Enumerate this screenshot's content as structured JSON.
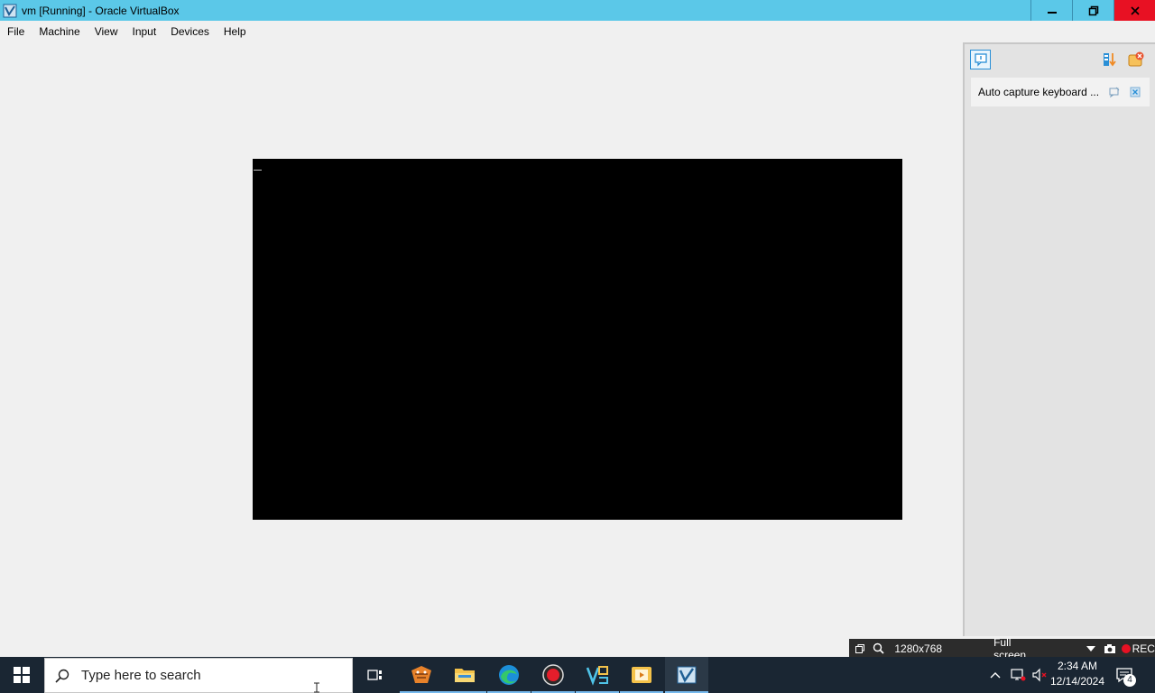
{
  "window": {
    "title": "vm [Running] - Oracle VirtualBox",
    "icon": "virtualbox-icon",
    "controls": [
      "minimize",
      "restore",
      "close"
    ]
  },
  "menubar": {
    "items": [
      {
        "label": "File"
      },
      {
        "label": "Machine"
      },
      {
        "label": "View"
      },
      {
        "label": "Input"
      },
      {
        "label": "Devices"
      },
      {
        "label": "Help"
      }
    ]
  },
  "vm": {
    "screen_color": "#000000"
  },
  "notification_panel": {
    "message": "Auto capture keyboard ...",
    "icons": [
      "speech-bubble-icon",
      "sort-arrows-icon",
      "close-all-icon"
    ]
  },
  "statusbar": {
    "resolution": "1280x768",
    "scale_mode": "Full screen",
    "rec_label": "REC"
  },
  "taskbar": {
    "search_placeholder": "Type here to search",
    "apps": [
      "task-view-icon",
      "gitkraken-icon",
      "file-explorer-icon",
      "edge-icon",
      "record-icon",
      "vs-icon",
      "media-icon",
      "virtualbox-icon"
    ],
    "clock_time": "2:34 AM",
    "clock_date": "12/14/2024",
    "notification_count": "4"
  },
  "colors": {
    "titlebar": "#5bc8e8",
    "close_button": "#e81123",
    "taskbar": "#1a2633",
    "statusbar": "#2c2c2c",
    "accent": "#2a8fd6"
  }
}
